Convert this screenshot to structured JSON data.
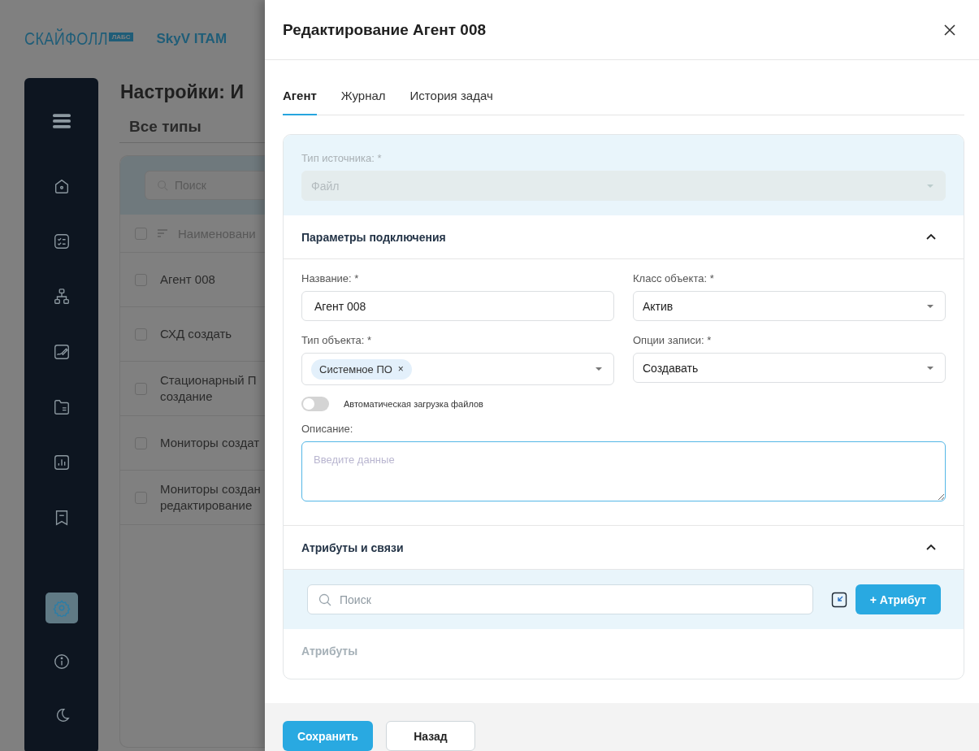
{
  "background": {
    "logo": {
      "brand": "СКАЙФОЛЛ",
      "badge": "ЛАБС",
      "product": "SkyV ITAM"
    },
    "sidebar": {
      "items": [
        {
          "kind": "home",
          "selected": false
        },
        {
          "kind": "tasks",
          "selected": false
        },
        {
          "kind": "network",
          "selected": false
        },
        {
          "kind": "sign",
          "selected": false
        },
        {
          "kind": "folder",
          "selected": false
        },
        {
          "kind": "chart",
          "selected": false
        },
        {
          "kind": "bookmark",
          "selected": false
        }
      ],
      "bottom_items": [
        {
          "kind": "settings",
          "selected": true
        },
        {
          "kind": "info",
          "selected": false
        },
        {
          "kind": "theme",
          "selected": false
        }
      ]
    },
    "page_title": "Настройки: И",
    "type_filter": "Все типы",
    "table": {
      "search_placeholder": "Поиск",
      "columns": [
        "Наименовани"
      ],
      "header_checked": false,
      "rows": [
        {
          "name": "Агент 008",
          "checked": false
        },
        {
          "name": "СХД создать",
          "checked": false
        },
        {
          "name": "Стационарный П\nсоздание",
          "checked": false
        },
        {
          "name": "Мониторы создат",
          "checked": false
        },
        {
          "name": "Мониторы создан\nредактирование",
          "checked": false
        }
      ]
    }
  },
  "drawer": {
    "title": "Редактирование Агент 008",
    "tabs": [
      {
        "label": "Агент",
        "selected": true
      },
      {
        "label": "Журнал",
        "selected": false
      },
      {
        "label": "История задач",
        "selected": false
      }
    ],
    "source_type": {
      "label": "Тип источника: *",
      "value": "Файл",
      "disabled": true
    },
    "sections": [
      {
        "title": "Параметры подключения",
        "expanded": true,
        "fields": [
          {
            "label": "Название: *",
            "kind": "text",
            "value": "Агент 008"
          },
          {
            "label": "Класс объекта: *",
            "kind": "select",
            "value": "Актив"
          },
          {
            "label": "Тип объекта: *",
            "kind": "tags",
            "tags": [
              {
                "label": "Системное ПО",
                "remove": "×"
              }
            ]
          },
          {
            "label": "Опции записи: *",
            "kind": "select",
            "value": "Создавать"
          }
        ],
        "toggle": {
          "label": "Автоматическая загрузка файлов",
          "on": false
        },
        "description": {
          "label": "Описание:",
          "placeholder": "Введите данные",
          "focused": true
        }
      },
      {
        "title": "Атрибуты и связи",
        "expanded": true,
        "search_placeholder": "Поиск",
        "add_button": "+ Атрибут",
        "list_title": "Атрибуты"
      }
    ],
    "buttons": [
      {
        "label": "Сохранить",
        "kind": "primary"
      },
      {
        "label": "Назад",
        "kind": "secondary"
      }
    ]
  }
}
